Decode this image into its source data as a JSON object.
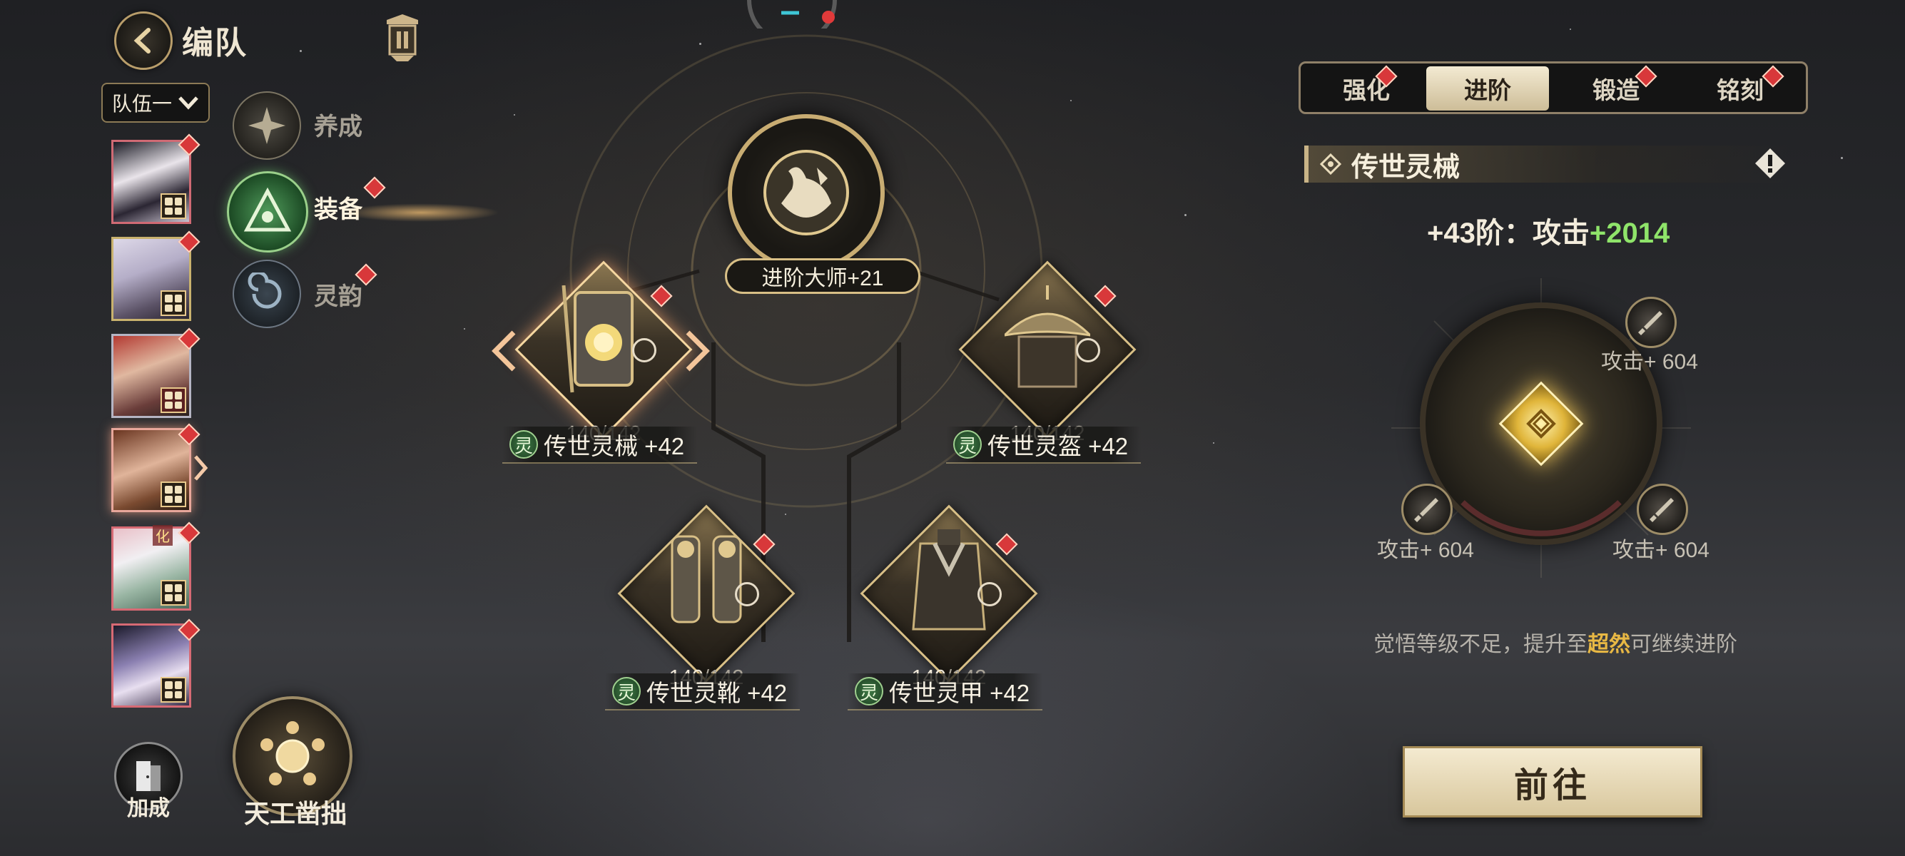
{
  "header": {
    "title": "编队"
  },
  "team": {
    "tab_label": "队伍一"
  },
  "portraits": {
    "badge_text": "化"
  },
  "side_menu": {
    "items": [
      {
        "label": "养成"
      },
      {
        "label": "装备"
      },
      {
        "label": "灵韵"
      }
    ]
  },
  "center": {
    "master_label": "进阶大师+21"
  },
  "equipment": [
    {
      "name": "传世灵械 +42",
      "level": "140",
      "max_level": "/142",
      "tag": "灵"
    },
    {
      "name": "传世灵盔 +42",
      "level": "140",
      "max_level": "/142",
      "tag": "灵"
    },
    {
      "name": "传世灵靴 +42",
      "level": "140",
      "max_level": "/142",
      "tag": "灵"
    },
    {
      "name": "传世灵甲 +42",
      "level": "140",
      "max_level": "/142",
      "tag": "灵"
    }
  ],
  "right_panel": {
    "tabs": [
      {
        "label": "强化"
      },
      {
        "label": "进阶"
      },
      {
        "label": "锻造"
      },
      {
        "label": "铭刻"
      }
    ],
    "section_title": "传世灵械",
    "stat_prefix": "+43阶：攻击",
    "stat_value": "+2014",
    "slots": [
      {
        "label": "攻击+ 604"
      },
      {
        "label": "攻击+ 604"
      },
      {
        "label": "攻击+ 604"
      }
    ],
    "hint_prefix": "觉悟等级不足，提升至",
    "hint_highlight": "超然",
    "hint_suffix": "可继续进阶",
    "go_button": "前往"
  },
  "bottom": {
    "bonus_label": "加成",
    "craft_label": "天工凿拙"
  },
  "colors": {
    "accent_gold": "#d8bf86",
    "stat_green": "#8fe46a",
    "highlight": "#e8b844",
    "red_dot": "#d8383a"
  }
}
